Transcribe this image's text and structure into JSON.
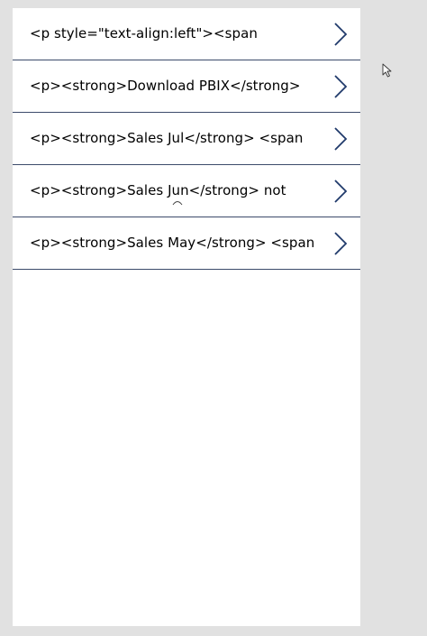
{
  "gallery": {
    "items": [
      {
        "label": "<p style=\"text-align:left\"><span",
        "icon": "chevron-right-icon"
      },
      {
        "label": "<p><strong>Download PBIX</strong>",
        "icon": "chevron-right-icon"
      },
      {
        "label": "<p><strong>Sales Jul</strong> <span",
        "icon": "chevron-right-icon"
      },
      {
        "label": "<p><strong>Sales Jun</strong> not",
        "icon": "chevron-right-icon"
      },
      {
        "label": "<p><strong>Sales May</strong> <span",
        "icon": "chevron-right-icon"
      }
    ]
  },
  "colors": {
    "background": "#e1e1e1",
    "screen": "#ffffff",
    "divider": "#3c4b6b",
    "chevron": "#203a6b"
  }
}
